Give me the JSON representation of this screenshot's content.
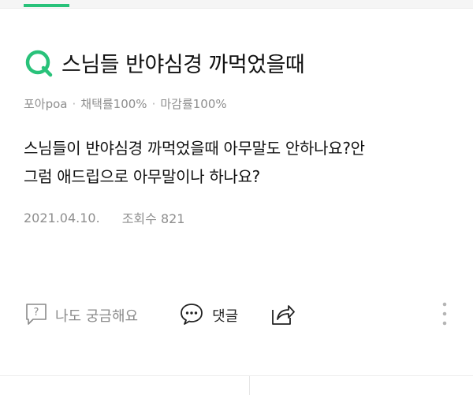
{
  "question": {
    "title": "스님들 반야심경 까먹었을때",
    "icon": "q-icon"
  },
  "meta": {
    "author": "포아poa",
    "adoption_rate": "채택률100%",
    "deadline_rate": "마감률100%"
  },
  "body": {
    "line1": "스님들이 반야심경 까먹었을때 아무말도 안하나요?안",
    "line2": "그럼 애드립으로 아무말이나 하나요?"
  },
  "info": {
    "date": "2021.04.10.",
    "views": "조회수 821"
  },
  "actions": {
    "curious_label": "나도 궁금해요",
    "comment_label": "댓글"
  },
  "colors": {
    "accent": "#29c27a",
    "meta_gray": "#8e8e8e"
  }
}
